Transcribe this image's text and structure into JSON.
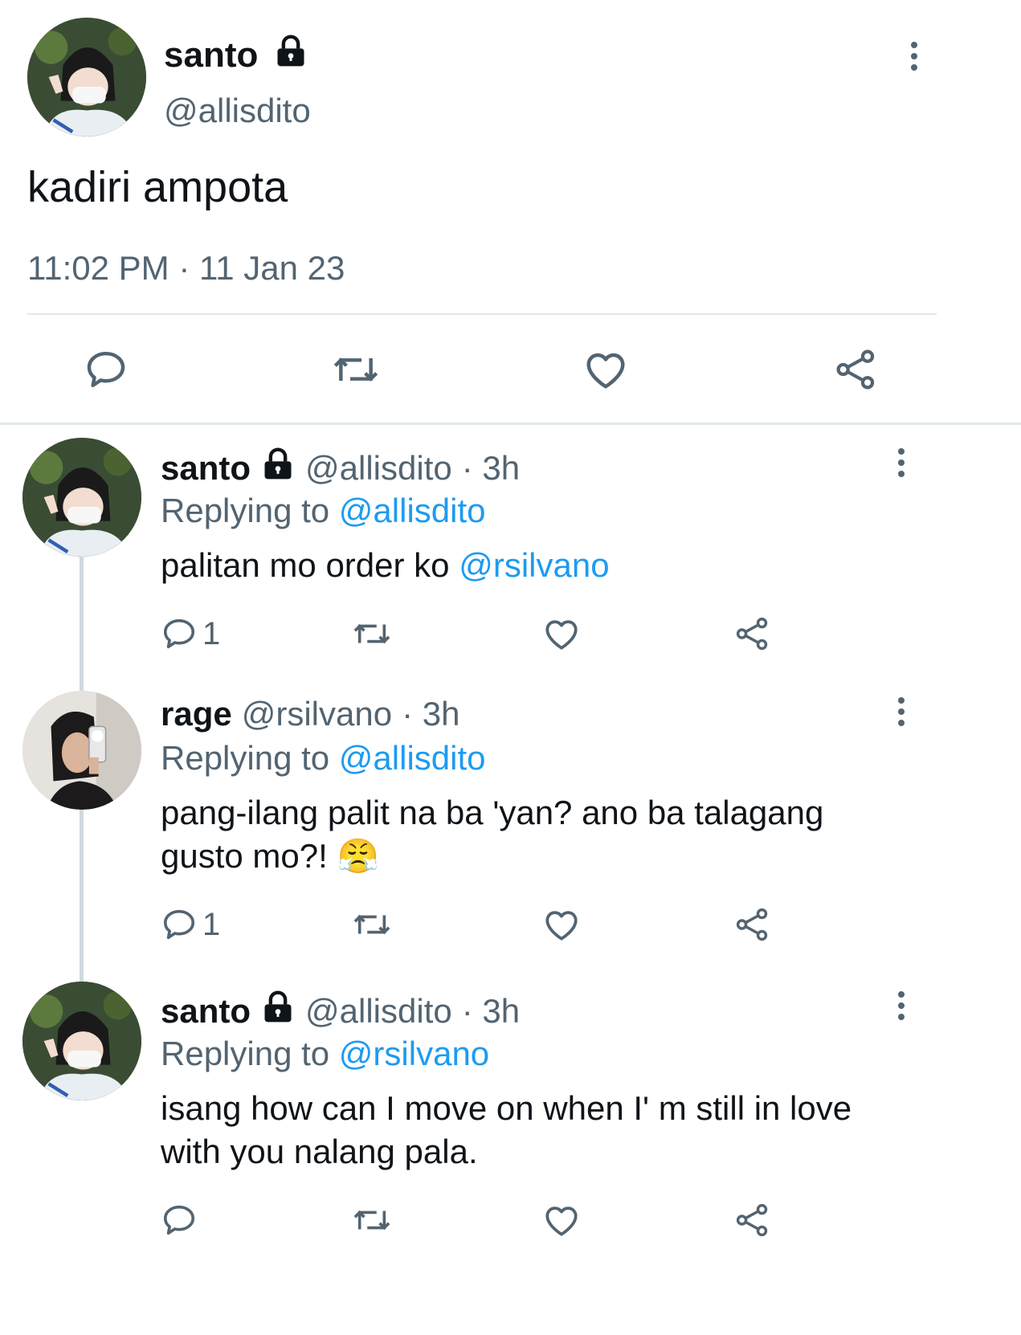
{
  "main_tweet": {
    "display_name": "santo",
    "handle": "@allisdito",
    "text": "kadiri ampota",
    "timestamp": "11:02 PM · 11 Jan 23",
    "locked": true
  },
  "replies": [
    {
      "display_name": "santo",
      "handle": "@allisdito",
      "age": "· 3h",
      "replying_label": "Replying to",
      "replying_to": "@allisdito",
      "text": "palitan mo order ko",
      "mention": "@rsilvano",
      "reply_count": "1",
      "locked": true
    },
    {
      "display_name": "rage",
      "handle": "@rsilvano",
      "age": "· 3h",
      "replying_label": "Replying to",
      "replying_to": "@allisdito",
      "text_line1": "pang-ilang palit na ba 'yan? ano ba talagang",
      "text_line2": "gusto mo?!",
      "emoji": "😤",
      "reply_count": "1",
      "locked": false
    },
    {
      "display_name": "santo",
      "handle": "@allisdito",
      "age": "· 3h",
      "replying_label": "Replying to",
      "replying_to": "@rsilvano",
      "text_line1": "isang how can I move on when I' m still in love",
      "text_line2": "with you nalang pala.",
      "reply_count": "",
      "locked": true
    }
  ],
  "colors": {
    "text": "#0f1419",
    "muted": "#536471",
    "link": "#1d9bf0",
    "divider": "#e1e8ed",
    "thread_line": "#cfd9de"
  },
  "icons": [
    "lock-icon",
    "more-icon",
    "reply-icon",
    "retweet-icon",
    "like-icon",
    "share-icon"
  ]
}
